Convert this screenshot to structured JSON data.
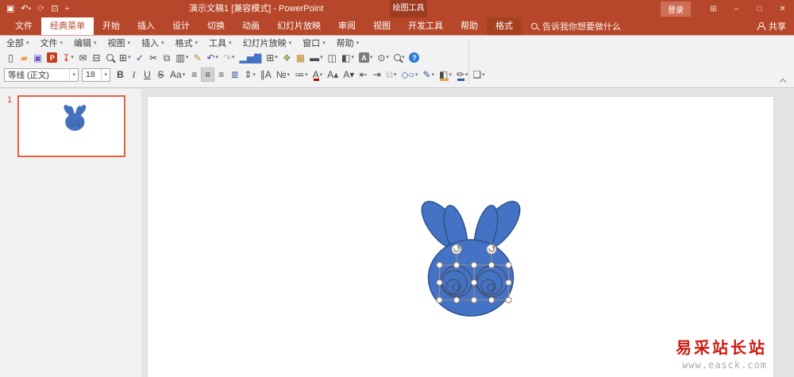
{
  "ui": {
    "caret": "▾"
  },
  "titlebar": {
    "title": "演示文稿1 [兼容模式] - PowerPoint",
    "contextual_tab_group": "绘图工具",
    "signin": "登录",
    "qat": [
      {
        "name": "save",
        "glyph": "▣"
      },
      {
        "name": "undo",
        "glyph": "↶",
        "dropdown": true
      },
      {
        "name": "redo",
        "glyph": "⟳",
        "muted": true
      },
      {
        "name": "start-slideshow",
        "glyph": "⊡"
      },
      {
        "name": "customize-qat",
        "glyph": "÷"
      }
    ],
    "window": [
      {
        "name": "ribbon-display-options",
        "glyph": "⊞"
      },
      {
        "name": "minimize",
        "glyph": "–"
      },
      {
        "name": "maximize",
        "glyph": "□"
      },
      {
        "name": "close",
        "glyph": "✕"
      }
    ]
  },
  "tabs": {
    "items": [
      {
        "label": "文件",
        "name": "file"
      },
      {
        "label": "经典菜单",
        "name": "classic-menu",
        "selected": true
      },
      {
        "label": "开始",
        "name": "home"
      },
      {
        "label": "插入",
        "name": "insert"
      },
      {
        "label": "设计",
        "name": "design"
      },
      {
        "label": "切换",
        "name": "transitions"
      },
      {
        "label": "动画",
        "name": "animations"
      },
      {
        "label": "幻灯片放映",
        "name": "slide-show"
      },
      {
        "label": "审阅",
        "name": "review"
      },
      {
        "label": "视图",
        "name": "view"
      },
      {
        "label": "开发工具",
        "name": "developer"
      },
      {
        "label": "帮助",
        "name": "help"
      },
      {
        "label": "格式",
        "name": "format",
        "contextual": true
      }
    ],
    "search_placeholder": "告诉我你想要做什么",
    "share": "共享"
  },
  "menubar": {
    "items": [
      {
        "label": "全部",
        "name": "all"
      },
      {
        "label": "文件",
        "name": "file"
      },
      {
        "label": "编辑",
        "name": "edit"
      },
      {
        "label": "视图",
        "name": "view"
      },
      {
        "label": "插入",
        "name": "insert"
      },
      {
        "label": "格式",
        "name": "format"
      },
      {
        "label": "工具",
        "name": "tools"
      },
      {
        "label": "幻灯片放映",
        "name": "slide-show"
      },
      {
        "label": "窗口",
        "name": "window"
      },
      {
        "label": "帮助",
        "name": "help"
      }
    ]
  },
  "toolbar1": {
    "items": [
      {
        "name": "new-presentation",
        "glyph": "▯"
      },
      {
        "name": "open",
        "glyph": "▰",
        "color": "#E8A33D"
      },
      {
        "name": "save",
        "glyph": "▣",
        "color": "#6A5ACD"
      },
      {
        "name": "save-as-ppt",
        "type": "box",
        "glyph": "P",
        "color": "#C43E1C"
      },
      {
        "name": "export",
        "glyph": "↧",
        "color": "#C43E1C",
        "dropdown": true
      },
      {
        "name": "mail",
        "glyph": "✉"
      },
      {
        "name": "print",
        "glyph": "⊟"
      },
      {
        "name": "print-preview",
        "type": "mag"
      },
      {
        "name": "page-setup",
        "glyph": "⊞",
        "dropdown": true
      },
      {
        "name": "spelling",
        "glyph": "✓",
        "color": "#2B579A"
      },
      {
        "name": "cut",
        "glyph": "✂"
      },
      {
        "name": "copy",
        "glyph": "⧉"
      },
      {
        "name": "paste",
        "glyph": "▥",
        "dropdown": true
      },
      {
        "name": "format-painter",
        "glyph": "✎",
        "color": "#C08A4B"
      },
      {
        "name": "undo",
        "glyph": "↶",
        "color": "#2B579A",
        "dropdown": true
      },
      {
        "name": "redo",
        "glyph": "↷",
        "muted": true,
        "dropdown": true
      },
      {
        "name": "insert-chart",
        "glyph": "▂▅▇",
        "color": "#4472C4"
      },
      {
        "name": "insert-table",
        "glyph": "⊞",
        "dropdown": true
      },
      {
        "name": "insert-smartart",
        "glyph": "❖",
        "color": "#7B9E4D"
      },
      {
        "name": "photo-album",
        "glyph": "▦",
        "color": "#C28A2F"
      },
      {
        "name": "new-slide",
        "glyph": "▬",
        "dropdown": true
      },
      {
        "name": "duplicate-slide",
        "glyph": "◫"
      },
      {
        "name": "slide-layout",
        "glyph": "◧",
        "dropdown": true
      },
      {
        "name": "text-box",
        "type": "box",
        "glyph": "A",
        "color": "#7A7A7A",
        "dropdown": true
      },
      {
        "name": "comment",
        "glyph": "⊙",
        "dropdown": true
      },
      {
        "name": "zoom",
        "type": "mag",
        "dropdown": true
      },
      {
        "name": "help",
        "type": "circle",
        "glyph": "?",
        "color": "#2B7CD3"
      }
    ]
  },
  "toolbar2": {
    "font_name": "等线 (正文)",
    "font_size": "18",
    "items": [
      {
        "name": "bold",
        "glyph": "B",
        "cls": "b"
      },
      {
        "name": "italic",
        "glyph": "I",
        "cls": "i"
      },
      {
        "name": "underline",
        "glyph": "U",
        "cls": "u"
      },
      {
        "name": "strikethrough",
        "glyph": "S",
        "cls": "s"
      },
      {
        "name": "change-case",
        "glyph": "Aa",
        "dropdown": true
      },
      {
        "name": "align-left",
        "glyph": "≡"
      },
      {
        "name": "align-center",
        "glyph": "≡",
        "active": true
      },
      {
        "name": "align-right",
        "glyph": "≡"
      },
      {
        "name": "distribute-text",
        "glyph": "≣",
        "color": "#2B579A"
      },
      {
        "name": "line-spacing",
        "glyph": "⇕",
        "dropdown": true
      },
      {
        "name": "text-direction",
        "glyph": "∥A"
      },
      {
        "name": "numbering",
        "glyph": "№",
        "dropdown": true
      },
      {
        "name": "bullets",
        "glyph": "≔",
        "dropdown": true
      },
      {
        "name": "font-color",
        "glyph": "A",
        "bar": "#C00000",
        "dropdown": true
      },
      {
        "name": "grow-font",
        "glyph": "A▴"
      },
      {
        "name": "shrink-font",
        "glyph": "A▾"
      },
      {
        "name": "decrease-indent",
        "glyph": "⇤"
      },
      {
        "name": "increase-indent",
        "glyph": "⇥"
      },
      {
        "name": "group",
        "glyph": "⧉",
        "muted": true,
        "dropdown": true
      },
      {
        "name": "shapes",
        "glyph": "◇○",
        "color": "#2B579A",
        "dropdown": true
      },
      {
        "name": "shape-quick-style",
        "glyph": "✎",
        "color": "#2B579A",
        "dropdown": true
      },
      {
        "name": "shape-fill",
        "glyph": "◧",
        "bar": "#E8A33D",
        "dropdown": true
      },
      {
        "name": "shape-outline",
        "glyph": "✏",
        "bar": "#2B579A",
        "dropdown": true
      },
      {
        "name": "shape-effects",
        "glyph": "❏",
        "dropdown": true
      }
    ]
  },
  "slides_panel": {
    "slide_number": "1"
  },
  "canvas": {
    "shape_fill": "#4472C4",
    "shape_stroke": "#2F528F",
    "eye_stroke": "#414E68",
    "selection_color": "#9B9186"
  },
  "watermark": {
    "line1": "易采站长站",
    "line2": "www.easck.com"
  }
}
